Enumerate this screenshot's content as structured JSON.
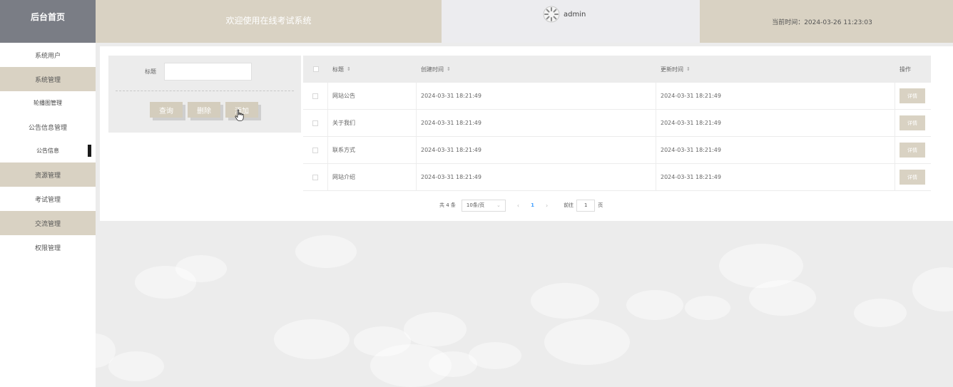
{
  "header": {
    "brand": "后台首页",
    "welcome": "欢迎使用在线考试系统",
    "username": "admin",
    "current_time": "当前时间：2024-03-26 11:23:03"
  },
  "sidebar": {
    "items": [
      {
        "label": "系统用户"
      },
      {
        "label": "系统管理"
      },
      {
        "label": "轮播图管理"
      },
      {
        "label": "公告信息管理"
      },
      {
        "label": "公告信息"
      },
      {
        "label": "资源管理"
      },
      {
        "label": "考试管理"
      },
      {
        "label": "交流管理"
      },
      {
        "label": "权限管理"
      }
    ]
  },
  "search": {
    "label": "标题",
    "value": "",
    "buttons": {
      "query": "查询",
      "delete": "删除",
      "add": "添加"
    }
  },
  "table": {
    "headers": {
      "title": "标题",
      "created": "创建时间",
      "updated": "更新时间",
      "op": "操作"
    },
    "sort_glyph": "⇕",
    "detail_label": "详情",
    "rows": [
      {
        "title": "网站公告",
        "created": "2024-03-31 18:21:49",
        "updated": "2024-03-31 18:21:49"
      },
      {
        "title": "关于我们",
        "created": "2024-03-31 18:21:49",
        "updated": "2024-03-31 18:21:49"
      },
      {
        "title": "联系方式",
        "created": "2024-03-31 18:21:49",
        "updated": "2024-03-31 18:21:49"
      },
      {
        "title": "网站介绍",
        "created": "2024-03-31 18:21:49",
        "updated": "2024-03-31 18:21:49"
      }
    ]
  },
  "pagination": {
    "total": "共 4 条",
    "page_size": "10条/页",
    "current_page": "1",
    "goto_label": "前往",
    "goto_value": "1",
    "page_unit": "页"
  },
  "colors": {
    "accent_tan": "#d9d2c3",
    "brand_gray": "#7a7d85",
    "page_link": "#409eff"
  }
}
